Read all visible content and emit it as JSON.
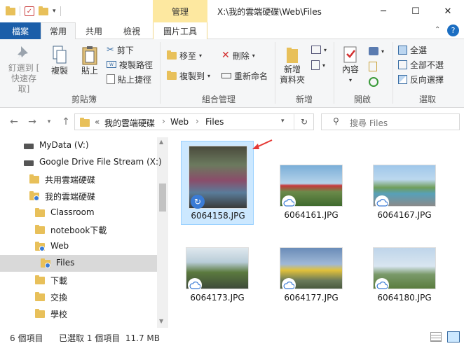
{
  "window": {
    "title": "X:\\我的雲端硬碟\\Web\\Files",
    "context_tab": "管理",
    "minimize": "─",
    "maximize": "☐",
    "close": "✕"
  },
  "tabs": {
    "file": "檔案",
    "home": "常用",
    "share": "共用",
    "view": "檢視",
    "picture_tools": "圖片工具"
  },
  "ribbon": {
    "pin": "釘選到 [\n快速存取]",
    "copy": "複製",
    "paste": "貼上",
    "cut": "剪下",
    "copy_path": "複製路徑",
    "paste_shortcut": "貼上捷徑",
    "clipboard": "剪貼簿",
    "move_to": "移至",
    "copy_to": "複製到",
    "delete": "刪除",
    "rename": "重新命名",
    "organize": "組合管理",
    "new_folder": "新增\n資料夾",
    "new": "新增",
    "properties": "內容",
    "open": "開啟",
    "select_all": "全選",
    "select_none": "全部不選",
    "invert": "反向選擇",
    "select": "選取"
  },
  "address": {
    "prefix": "«",
    "crumbs": [
      "我的雲端硬碟",
      "Web",
      "Files"
    ],
    "sep": "›",
    "search_placeholder": "搜尋 Files"
  },
  "nav": [
    {
      "label": "MyData (V:)",
      "indent": 34,
      "icon": "drive"
    },
    {
      "label": "Google Drive File Stream (X:)",
      "indent": 34,
      "icon": "drive"
    },
    {
      "label": "共用雲端硬碟",
      "indent": 42,
      "icon": "folder"
    },
    {
      "label": "我的雲端硬碟",
      "indent": 42,
      "icon": "folder-sync"
    },
    {
      "label": "Classroom",
      "indent": 50,
      "icon": "folder"
    },
    {
      "label": "notebook下載",
      "indent": 50,
      "icon": "folder"
    },
    {
      "label": "Web",
      "indent": 50,
      "icon": "folder-sync"
    },
    {
      "label": "Files",
      "indent": 58,
      "icon": "folder-sync"
    },
    {
      "label": "下載",
      "indent": 50,
      "icon": "folder"
    },
    {
      "label": "交換",
      "indent": 50,
      "icon": "folder"
    },
    {
      "label": "學校",
      "indent": 50,
      "icon": "folder"
    }
  ],
  "files": [
    {
      "name": "6064158.JPG",
      "status": "sync"
    },
    {
      "name": "6064161.JPG",
      "status": "cloud"
    },
    {
      "name": "6064167.JPG",
      "status": "cloud"
    },
    {
      "name": "6064173.JPG",
      "status": "cloud"
    },
    {
      "name": "6064177.JPG",
      "status": "cloud"
    },
    {
      "name": "6064180.JPG",
      "status": "cloud"
    }
  ],
  "status": {
    "count": "6 個項目",
    "selected": "已選取 1 個項目  11.7 MB"
  },
  "colors": {
    "accent": "#1b5ea9",
    "context": "#fde8a0",
    "selected": "#cce8ff",
    "arrow": "#e53935"
  }
}
